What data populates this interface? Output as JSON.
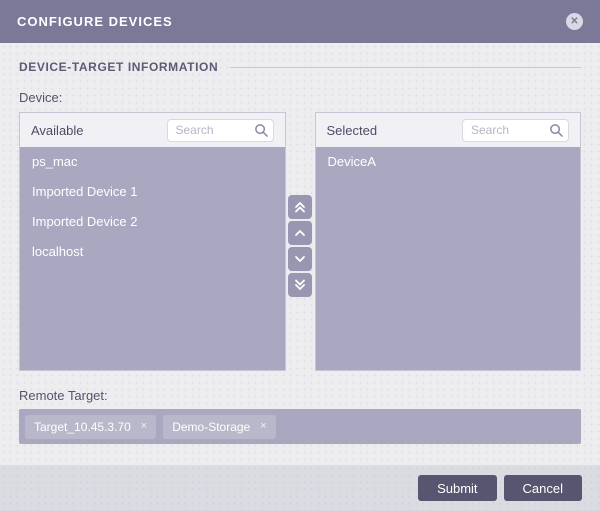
{
  "dialog": {
    "title": "CONFIGURE DEVICES"
  },
  "section": {
    "title": "DEVICE-TARGET INFORMATION"
  },
  "device": {
    "label": "Device:",
    "available": {
      "title": "Available",
      "search_placeholder": "Search",
      "search_value": "",
      "items": [
        "ps_mac",
        "Imported Device 1",
        "Imported Device 2",
        "localhost"
      ]
    },
    "selected": {
      "title": "Selected",
      "search_placeholder": "Search",
      "search_value": "",
      "items": [
        "DeviceA"
      ]
    },
    "transfer_buttons": [
      "move-all-up",
      "move-up",
      "move-down",
      "move-all-down"
    ]
  },
  "remote_target": {
    "label": "Remote Target:",
    "tags": [
      {
        "label": "Target_10.45.3.70"
      },
      {
        "label": "Demo-Storage"
      }
    ],
    "remove_glyph": "×"
  },
  "footer": {
    "submit_label": "Submit",
    "cancel_label": "Cancel"
  },
  "icons": {
    "close_glyph": "✕",
    "search": "magnifier"
  },
  "colors": {
    "header_bg": "#7c7897",
    "body_bg": "#ededf0",
    "list_bg": "#a9a8c0",
    "tag_bg": "#b9b8ca",
    "button_bg": "#585570",
    "footer_bg": "#dbdbe2",
    "text_on_dark": "#ffffff",
    "label_text": "#55526b"
  }
}
